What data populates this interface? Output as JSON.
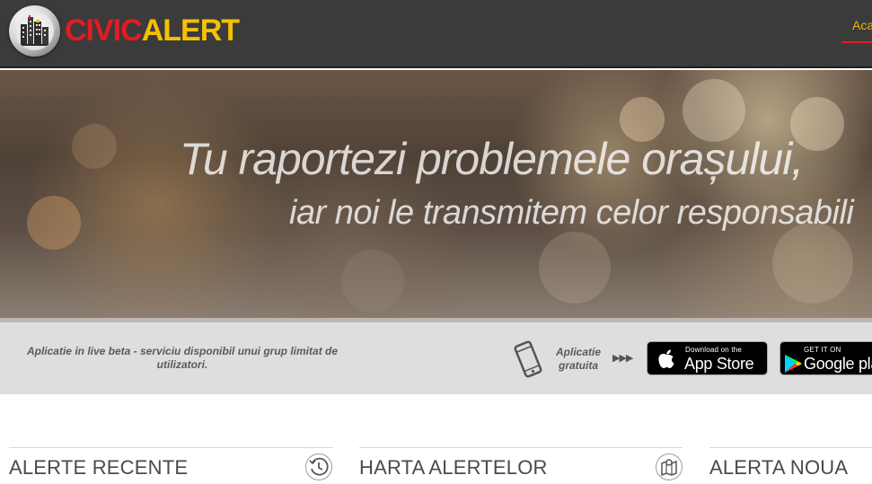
{
  "header": {
    "logo_icon": "city-buildings-icon",
    "logo_part1": "CIVIC",
    "logo_part2": "ALERT",
    "nav": [
      {
        "label": "Aca"
      }
    ],
    "colors": {
      "civic": "#e21b23",
      "alert": "#f4c000",
      "header_bg": "#3b3b3b"
    }
  },
  "hero": {
    "line1": "Tu raportezi problemele orașului,",
    "line2": "iar noi le transmitem celor responsabili"
  },
  "beta_strip": {
    "notice": "Aplicatie in live beta - serviciu disponibil unui grup limitat de utilizatori.",
    "app_label": "Aplicatie gratuita",
    "phone_icon": "smartphone-icon",
    "arrows": "▶▶▶",
    "app_store": {
      "small": "Download on the",
      "big": "App Store",
      "icon": "apple-icon"
    },
    "google_play": {
      "small": "GET IT ON",
      "big": "Google play",
      "icon": "google-play-icon"
    }
  },
  "sections": [
    {
      "title": "ALERTE RECENTE",
      "icon": "clock-history-icon"
    },
    {
      "title": "HARTA ALERTELOR",
      "icon": "map-icon"
    },
    {
      "title": "ALERTA NOUA",
      "icon": ""
    }
  ]
}
